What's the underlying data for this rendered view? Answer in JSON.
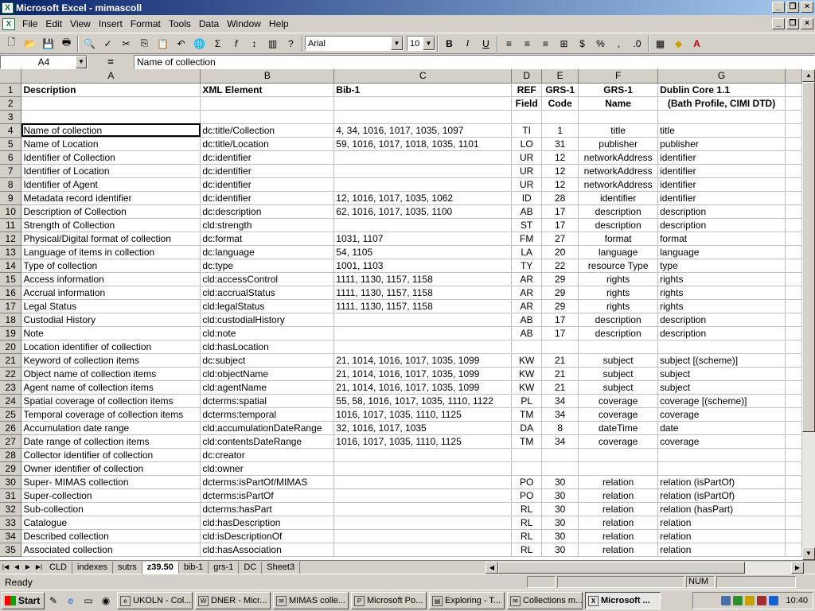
{
  "window": {
    "title": "Microsoft Excel - mimascoll"
  },
  "menu": [
    "File",
    "Edit",
    "View",
    "Insert",
    "Format",
    "Tools",
    "Data",
    "Window",
    "Help"
  ],
  "toolbar": {
    "font": "Arial",
    "size": "10"
  },
  "formula": {
    "cell": "A4",
    "eq": "=",
    "value": "Name of collection"
  },
  "columns": [
    "A",
    "B",
    "C",
    "D",
    "E",
    "F",
    "G"
  ],
  "rows": [
    {
      "n": "1",
      "cells": [
        "Description",
        "XML Element",
        "Bib-1",
        "REF",
        "GRS-1",
        "GRS-1",
        "Dublin Core 1.1"
      ],
      "bold": true
    },
    {
      "n": "2",
      "cells": [
        "",
        "",
        "",
        "Field",
        "Code",
        "Name",
        "(Bath Profile, CIMI DTD)"
      ],
      "bold": true
    },
    {
      "n": "3",
      "cells": [
        "",
        "",
        "",
        "",
        "",
        "",
        ""
      ]
    },
    {
      "n": "4",
      "cells": [
        "Name of collection",
        "dc:title/Collection",
        "4, 34, 1016, 1017, 1035, 1097",
        "TI",
        "1",
        "title",
        "title"
      ]
    },
    {
      "n": "5",
      "cells": [
        "Name of Location",
        "dc:title/Location",
        "59, 1016, 1017, 1018, 1035, 1101",
        "LO",
        "31",
        "publisher",
        "publisher"
      ]
    },
    {
      "n": "6",
      "cells": [
        "Identifier of Collection",
        "dc:identifier",
        "",
        "UR",
        "12",
        "networkAddress",
        "identifier"
      ]
    },
    {
      "n": "7",
      "cells": [
        "Identifier of Location",
        "dc:identifier",
        "",
        "UR",
        "12",
        "networkAddress",
        "identifier"
      ]
    },
    {
      "n": "8",
      "cells": [
        "Identifier of Agent",
        "dc:identifier",
        "",
        "UR",
        "12",
        "networkAddress",
        "identifier"
      ]
    },
    {
      "n": "9",
      "cells": [
        "Metadata record identifier",
        "dc:identifier",
        "12, 1016, 1017, 1035, 1062",
        "ID",
        "28",
        "identifier",
        "identifier"
      ]
    },
    {
      "n": "10",
      "cells": [
        "Description of Collection",
        "dc:description",
        "62, 1016, 1017, 1035, 1100",
        "AB",
        "17",
        "description",
        "description"
      ]
    },
    {
      "n": "11",
      "cells": [
        "Strength of Collection",
        "cld:strength",
        "",
        "ST",
        "17",
        "description",
        "description"
      ]
    },
    {
      "n": "12",
      "cells": [
        "Physical/Digital format of collection",
        "dc:format",
        "1031, 1107",
        "FM",
        "27",
        "format",
        "format"
      ]
    },
    {
      "n": "13",
      "cells": [
        "Language of items in collection",
        "dc:language",
        "54, 1105",
        "LA",
        "20",
        "language",
        "language"
      ]
    },
    {
      "n": "14",
      "cells": [
        "Type of collection",
        "dc:type",
        "1001, 1103",
        "TY",
        "22",
        "resource Type",
        "type"
      ]
    },
    {
      "n": "15",
      "cells": [
        "Access information",
        "cld:accessControl",
        "1111, 1130, 1157, 1158",
        "AR",
        "29",
        "rights",
        "rights"
      ]
    },
    {
      "n": "16",
      "cells": [
        "Accrual information",
        "cld:accrualStatus",
        "1111, 1130, 1157, 1158",
        "AR",
        "29",
        "rights",
        "rights"
      ]
    },
    {
      "n": "17",
      "cells": [
        "Legal Status",
        "cld:legalStatus",
        "1111, 1130, 1157, 1158",
        "AR",
        "29",
        "rights",
        "rights"
      ]
    },
    {
      "n": "18",
      "cells": [
        "Custodial History",
        "cld:custodialHistory",
        "",
        "AB",
        "17",
        "description",
        "description"
      ]
    },
    {
      "n": "19",
      "cells": [
        "Note",
        "cld:note",
        "",
        "AB",
        "17",
        "description",
        "description"
      ]
    },
    {
      "n": "20",
      "cells": [
        "Location identifier of collection",
        "cld:hasLocation",
        "",
        "",
        "",
        "",
        ""
      ]
    },
    {
      "n": "21",
      "cells": [
        "Keyword of collection items",
        "dc:subject",
        "21, 1014, 1016, 1017, 1035, 1099",
        "KW",
        "21",
        "subject",
        "subject [(scheme)]"
      ]
    },
    {
      "n": "22",
      "cells": [
        "Object name of collection items",
        "cld:objectName",
        "21, 1014, 1016, 1017, 1035, 1099",
        "KW",
        "21",
        "subject",
        "subject"
      ]
    },
    {
      "n": "23",
      "cells": [
        "Agent name of collection items",
        "cld:agentName",
        "21, 1014, 1016, 1017, 1035, 1099",
        "KW",
        "21",
        "subject",
        "subject"
      ]
    },
    {
      "n": "24",
      "cells": [
        "Spatial coverage of collection items",
        "dcterms:spatial",
        "55, 58, 1016, 1017, 1035, 1110, 1122",
        "PL",
        "34",
        "coverage",
        "coverage [(scheme)]"
      ]
    },
    {
      "n": "25",
      "cells": [
        "Temporal coverage of collection items",
        "dcterms:temporal",
        "1016, 1017, 1035, 1110, 1125",
        "TM",
        "34",
        "coverage",
        "coverage"
      ]
    },
    {
      "n": "26",
      "cells": [
        "Accumulation date range",
        "cld:accumulationDateRange",
        "32, 1016, 1017, 1035",
        "DA",
        "8",
        "dateTime",
        "date"
      ]
    },
    {
      "n": "27",
      "cells": [
        "Date range of collection items",
        "cld:contentsDateRange",
        "1016, 1017, 1035, 1110, 1125",
        "TM",
        "34",
        "coverage",
        "coverage"
      ]
    },
    {
      "n": "28",
      "cells": [
        "Collector identifier of collection",
        "dc:creator",
        "",
        "",
        "",
        "",
        ""
      ]
    },
    {
      "n": "29",
      "cells": [
        "Owner identifier of collection",
        "cld:owner",
        "",
        "",
        "",
        "",
        ""
      ]
    },
    {
      "n": "30",
      "cells": [
        "Super- MIMAS collection",
        "dcterms:isPartOf/MIMAS",
        "",
        "PO",
        "30",
        "relation",
        "relation (isPartOf)"
      ]
    },
    {
      "n": "31",
      "cells": [
        "Super-collection",
        "dcterms:isPartOf",
        "",
        "PO",
        "30",
        "relation",
        "relation (isPartOf)"
      ]
    },
    {
      "n": "32",
      "cells": [
        "Sub-collection",
        "dcterms:hasPart",
        "",
        "RL",
        "30",
        "relation",
        "relation (hasPart)"
      ]
    },
    {
      "n": "33",
      "cells": [
        "Catalogue",
        "cld:hasDescription",
        "",
        "RL",
        "30",
        "relation",
        "relation"
      ]
    },
    {
      "n": "34",
      "cells": [
        "Described collection",
        "cld:isDescriptionOf",
        "",
        "RL",
        "30",
        "relation",
        "relation"
      ]
    },
    {
      "n": "35",
      "cells": [
        "Associated collection",
        "cld:hasAssociation",
        "",
        "RL",
        "30",
        "relation",
        "relation"
      ]
    }
  ],
  "sheets": [
    "CLD",
    "indexes",
    "sutrs",
    "z39.50",
    "bib-1",
    "grs-1",
    "DC",
    "Sheet3"
  ],
  "active_sheet": "z39.50",
  "status": {
    "left": "Ready",
    "num": "NUM"
  },
  "taskbar": {
    "start": "Start",
    "tasks": [
      "UKOLN - Col...",
      "DNER - Micr...",
      "MIMAS colle...",
      "Microsoft Po...",
      "Exploring - T...",
      "Collections m...",
      "Microsoft ..."
    ],
    "active_task": "Microsoft ...",
    "clock": "10:40"
  }
}
